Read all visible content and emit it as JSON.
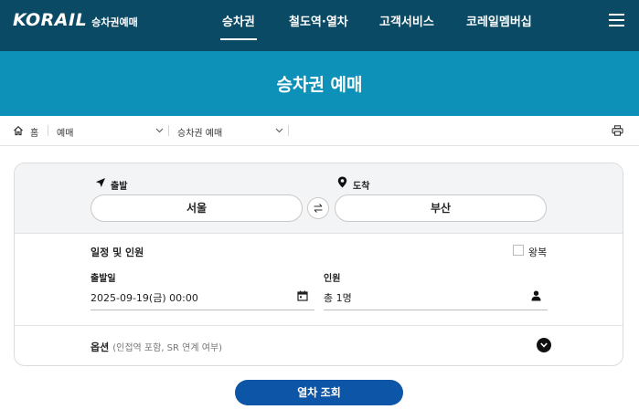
{
  "header": {
    "logo_text": "KORAIL",
    "logo_subtitle": "승차권예매",
    "nav": [
      {
        "label": "승차권"
      },
      {
        "label": "철도역·열차"
      },
      {
        "label": "고객서비스"
      },
      {
        "label": "코레일멤버십"
      }
    ],
    "menu_icon": "hamburger-icon"
  },
  "banner": {
    "title": "승차권 예매"
  },
  "breadcrumb": {
    "home_label": "홈",
    "level1": "예매",
    "level2": "승차권 예매",
    "print_icon": "printer-icon"
  },
  "route": {
    "departure_label": "출발",
    "arrival_label": "도착",
    "departure_value": "서울",
    "arrival_value": "부산"
  },
  "schedule": {
    "title": "일정 및 인원",
    "roundtrip_label": "왕복",
    "roundtrip_checked": false,
    "date_label": "출발일",
    "date_value": "2025-09-19(금) 00:00",
    "people_label": "인원",
    "people_value": "총 1명"
  },
  "options": {
    "title": "옵션",
    "subtitle": "(인접역 포함, SR 연계 여부)"
  },
  "search_button": "열차 조회",
  "colors": {
    "nav_bg": "#0b4a64",
    "banner_bg": "#0d91b8",
    "button_bg": "#0d55a6"
  }
}
